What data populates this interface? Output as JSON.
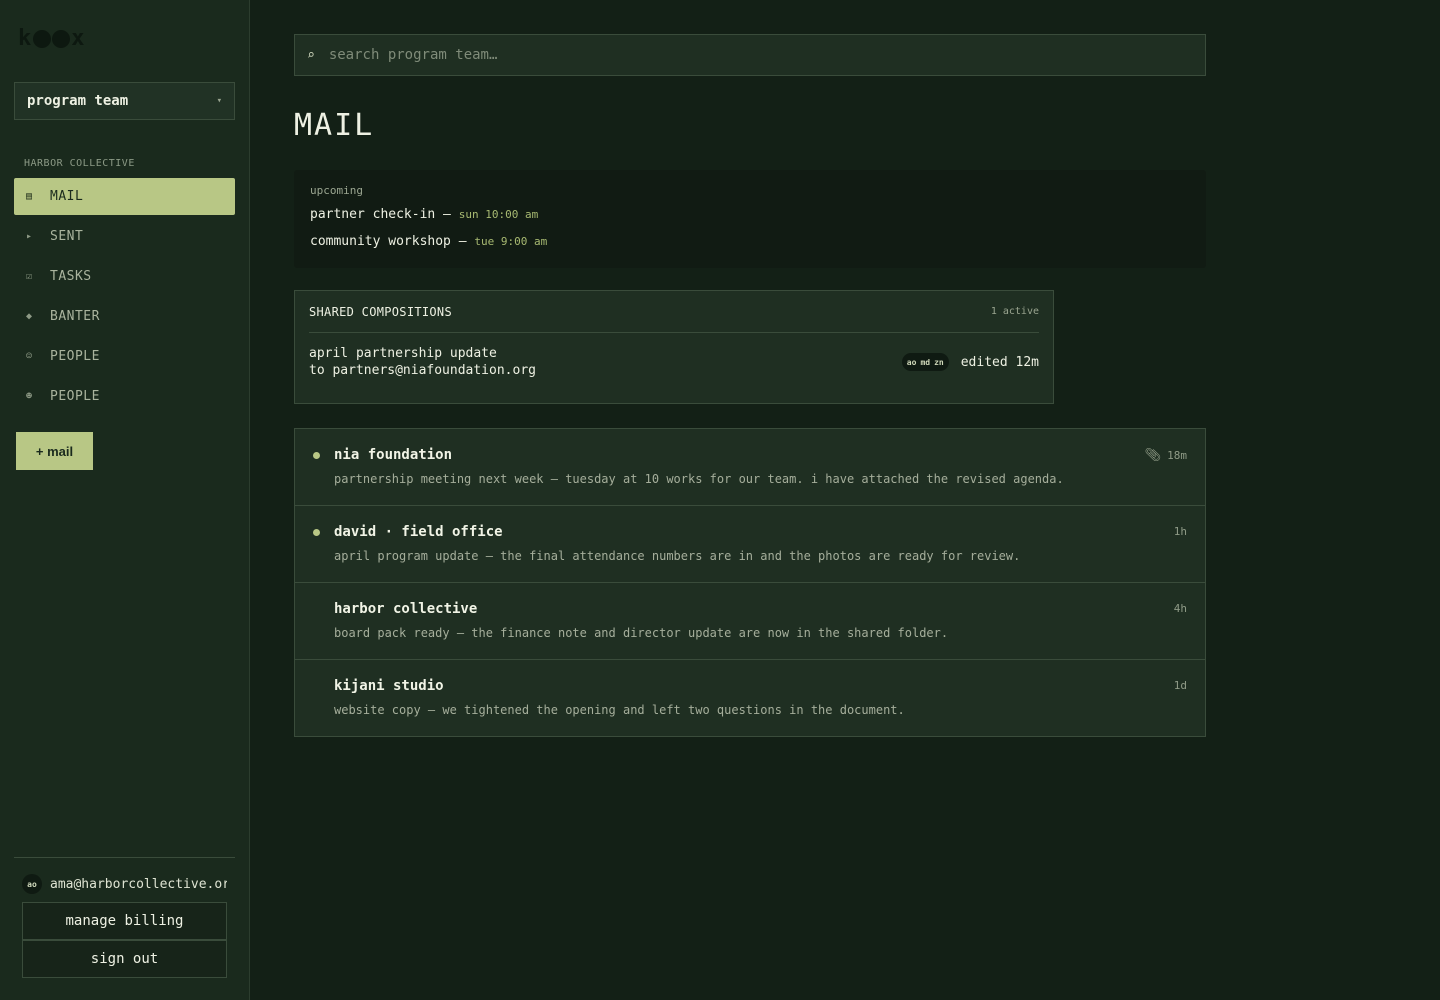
{
  "brand": {
    "logo_left": "k",
    "logo_right": "x"
  },
  "team_select": {
    "value": "program team"
  },
  "sidebar": {
    "org_label": "HARBOR COLLECTIVE",
    "items": [
      {
        "label": "MAIL",
        "icon": "▤"
      },
      {
        "label": "SENT",
        "icon": "▸"
      },
      {
        "label": "TASKS",
        "icon": "☑"
      },
      {
        "label": "BANTER",
        "icon": "◆"
      },
      {
        "label": "PEOPLE",
        "icon": "☺"
      },
      {
        "label": "PEOPLE",
        "icon": "☻"
      }
    ],
    "compose_label": "+ mail",
    "account": {
      "initials": "ao",
      "email": "ama@harborcollective.org"
    },
    "billing_label": "manage billing",
    "signout_label": "sign out"
  },
  "search": {
    "placeholder": "search program team…"
  },
  "page_title": "MAIL",
  "upcoming": {
    "label": "upcoming",
    "events": [
      {
        "title": "partner check-in —",
        "time": "sun 10:00 am"
      },
      {
        "title": "community workshop —",
        "time": "tue 9:00 am"
      }
    ]
  },
  "shared": {
    "title": "SHARED COMPOSITIONS",
    "count": "1 active",
    "item": {
      "subject": "april partnership update",
      "to": "to partners@niafoundation.org",
      "collaborators": [
        "ao",
        "md",
        "zn"
      ],
      "edited": "edited 12m"
    }
  },
  "messages": [
    {
      "sender": "nia foundation",
      "preview": "partnership meeting next week — tuesday at 10 works for our team. i have attached the revised agenda.",
      "time": "18m",
      "unread": true,
      "attachment": true
    },
    {
      "sender": "david · field office",
      "preview": "april program update — the final attendance numbers are in and the photos are ready for review.",
      "time": "1h",
      "unread": true,
      "attachment": false
    },
    {
      "sender": "harbor collective",
      "preview": "board pack ready — the finance note and director update are now in the shared folder.",
      "time": "4h",
      "unread": false,
      "attachment": false
    },
    {
      "sender": "kijani studio",
      "preview": "website copy — we tightened the opening and left two questions in the document.",
      "time": "1d",
      "unread": false,
      "attachment": false
    }
  ],
  "colors": {
    "accent": "#b8c785",
    "sidebar_bg": "#1a2a1d",
    "main_bg": "#132016"
  }
}
